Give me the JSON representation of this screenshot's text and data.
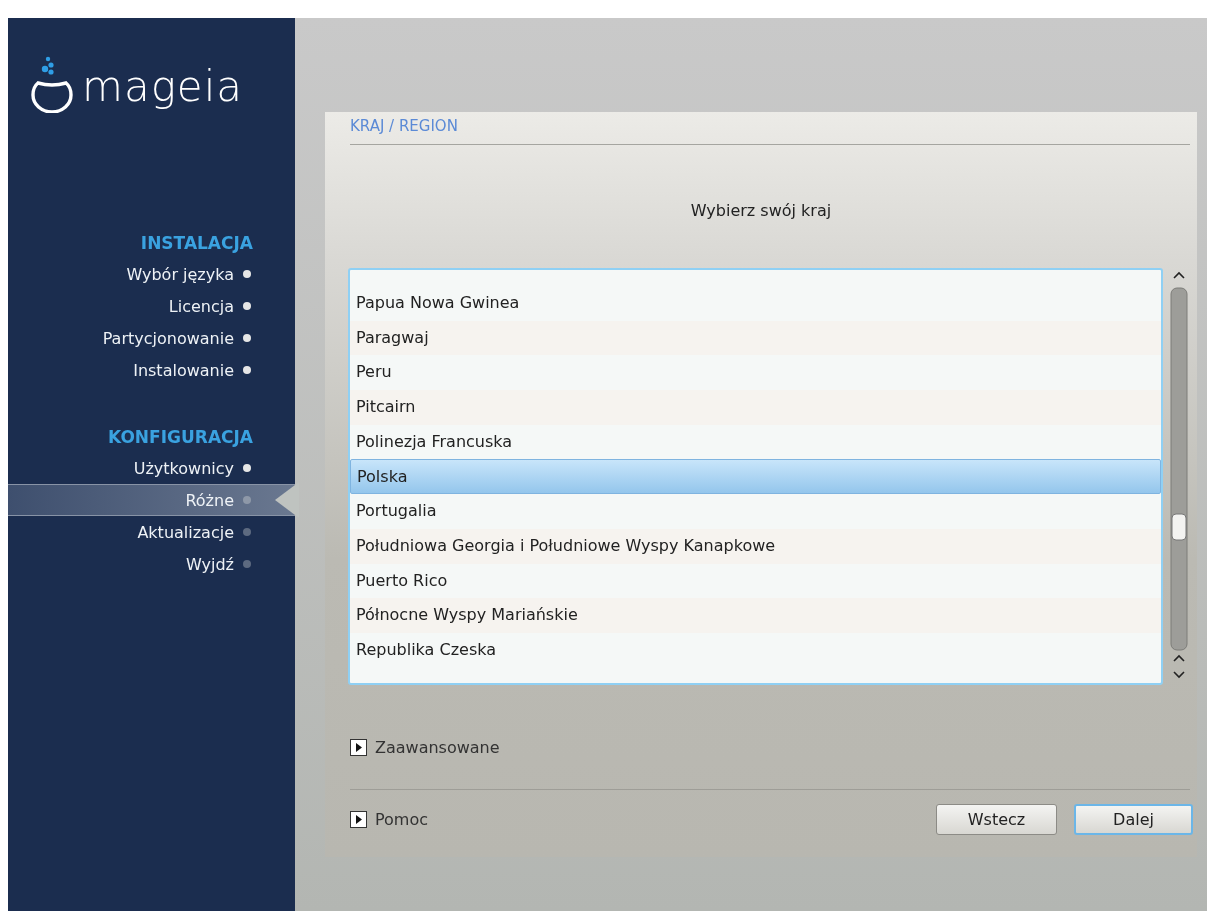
{
  "sidebar": {
    "logo_text": "mageia",
    "sections": [
      {
        "heading": "INSTALACJA",
        "items": [
          {
            "label": "Wybór języka",
            "completed": true,
            "selected": false
          },
          {
            "label": "Licencja",
            "completed": true,
            "selected": false
          },
          {
            "label": "Partycjonowanie",
            "completed": true,
            "selected": false
          },
          {
            "label": "Instalowanie",
            "completed": true,
            "selected": false
          }
        ]
      },
      {
        "heading": "KONFIGURACJA",
        "items": [
          {
            "label": "Użytkownicy",
            "completed": true,
            "selected": false
          },
          {
            "label": "Różne",
            "completed": false,
            "selected": true
          },
          {
            "label": "Aktualizacje",
            "completed": false,
            "selected": false
          },
          {
            "label": "Wyjdź",
            "completed": false,
            "selected": false
          }
        ]
      }
    ]
  },
  "page": {
    "title": "KRAJ / REGION",
    "prompt": "Wybierz swój kraj",
    "countries": [
      {
        "name": "Papua Nowa Gwinea",
        "selected": false
      },
      {
        "name": "Paragwaj",
        "selected": false
      },
      {
        "name": "Peru",
        "selected": false
      },
      {
        "name": "Pitcairn",
        "selected": false
      },
      {
        "name": "Polinezja Francuska",
        "selected": false
      },
      {
        "name": "Polska",
        "selected": true
      },
      {
        "name": "Portugalia",
        "selected": false
      },
      {
        "name": "Południowa Georgia i Południowe Wyspy Kanapkowe",
        "selected": false
      },
      {
        "name": "Puerto Rico",
        "selected": false
      },
      {
        "name": "Północne Wyspy Mariańskie",
        "selected": false
      },
      {
        "name": "Republika Czeska",
        "selected": false
      }
    ],
    "advanced": "Zaawansowane",
    "help": "Pomoc",
    "buttons": [
      {
        "label": "Wstecz",
        "focused": false
      },
      {
        "label": "Dalej",
        "focused": true
      }
    ]
  }
}
